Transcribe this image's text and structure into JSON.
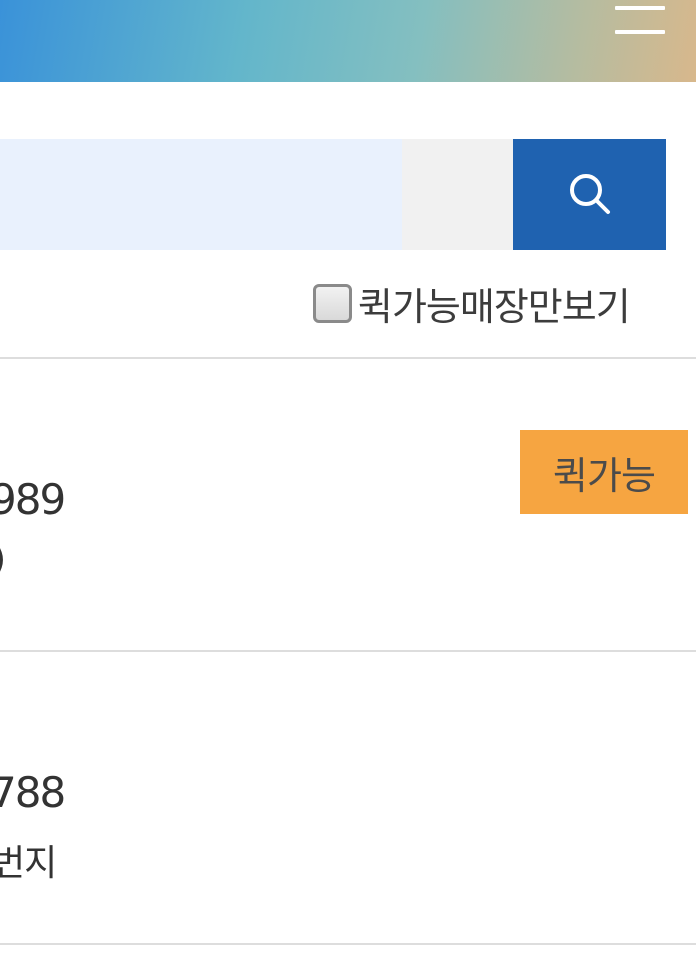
{
  "header": {
    "menu_icon": "hamburger-menu-icon"
  },
  "search": {
    "value": "",
    "placeholder": "",
    "button_icon": "search-icon",
    "colors": {
      "input_bg": "#e9f1fd",
      "button_bg": "#1f62b0"
    }
  },
  "filter": {
    "label": "퀵가능매장만보기",
    "checked": false
  },
  "stores": [
    {
      "phone": "989",
      "address": ")",
      "badge": "퀵가능"
    },
    {
      "phone": "788",
      "address": "번지",
      "badge": ""
    }
  ],
  "colors": {
    "badge_bg": "#f6a541",
    "divider": "#dddddd"
  }
}
